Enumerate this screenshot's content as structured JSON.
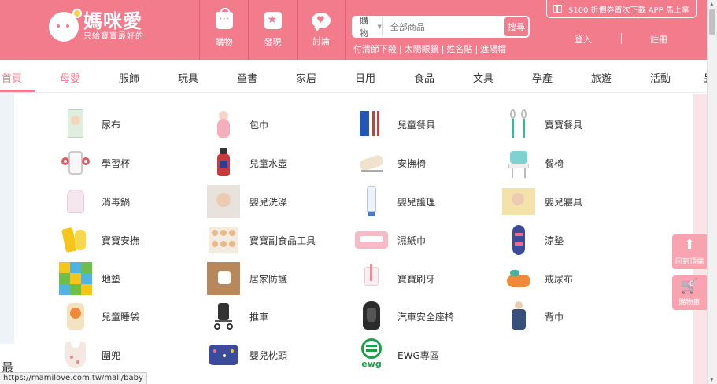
{
  "header": {
    "logo": {
      "title": "媽咪愛",
      "subtitle": "只給寶寶最好的"
    },
    "nav": [
      {
        "label": "購物",
        "icon": "shopping-bag-icon"
      },
      {
        "label": "發現",
        "icon": "star-icon"
      },
      {
        "label": "討論",
        "icon": "chat-heart-icon"
      }
    ],
    "search": {
      "category": "購物",
      "placeholder": "全部商品",
      "button": "搜尋"
    },
    "hot_links": [
      "付清節下殺",
      "太陽眼鏡",
      "姓名貼",
      "遮陽帽"
    ],
    "promo": "$100 折價券首次下載 APP 馬上拿",
    "login": "登入",
    "register": "註冊"
  },
  "categories": {
    "home": "首頁",
    "items": [
      "母嬰",
      "服飾",
      "玩具",
      "童書",
      "家居",
      "日用",
      "食品",
      "文具",
      "孕產",
      "旅遊",
      "活動",
      "品"
    ]
  },
  "dropdown": {
    "items": [
      "尿布",
      "包巾",
      "兒童餐具",
      "寶寶餐具",
      "學習杯",
      "兒童水壺",
      "安撫椅",
      "餐椅",
      "消毒鍋",
      "嬰兒洗澡",
      "嬰兒護理",
      "嬰兒寢具",
      "寶寶安撫",
      "寶寶副食品工具",
      "濕紙巾",
      "涼墊",
      "地墊",
      "居家防護",
      "寶寶刷牙",
      "戒尿布",
      "兒童睡袋",
      "推車",
      "汽車安全座椅",
      "背巾",
      "圍兜",
      "嬰兒枕頭",
      "EWG專區"
    ]
  },
  "float": {
    "back_to_top": "回到頂端",
    "cart": "購物車",
    "cart_count": "0"
  },
  "page_bottom_text": "最",
  "status_url": "https://mamilove.com.tw/mall/baby",
  "colors": {
    "brand": "#f27b8c",
    "float": "#f9a3b0"
  }
}
